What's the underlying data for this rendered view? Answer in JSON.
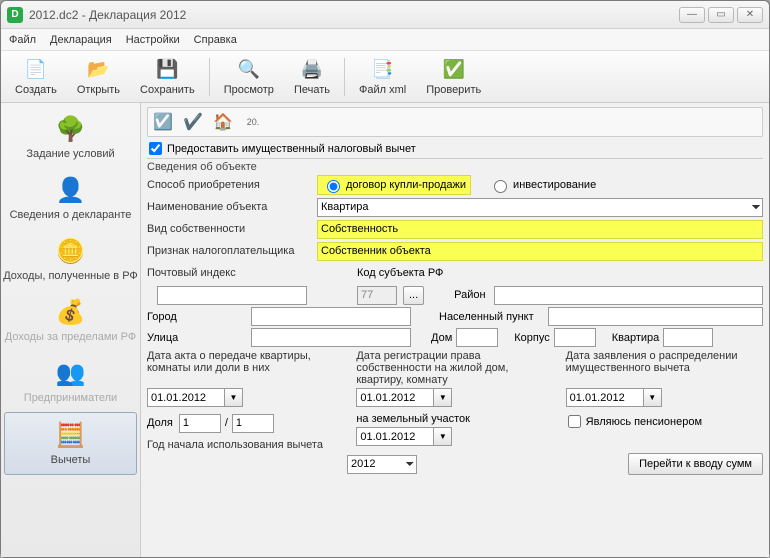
{
  "window": {
    "title": "2012.dc2 - Декларация 2012",
    "appicon": "D"
  },
  "menu": [
    "Файл",
    "Декларация",
    "Настройки",
    "Справка"
  ],
  "toolbar": {
    "create": "Создать",
    "open": "Открыть",
    "save": "Сохранить",
    "preview": "Просмотр",
    "print": "Печать",
    "xml": "Файл xml",
    "check": "Проверить"
  },
  "sidebar": {
    "items": [
      {
        "label": "Задание условий"
      },
      {
        "label": "Сведения о декларанте"
      },
      {
        "label": "Доходы, полученные в РФ"
      },
      {
        "label": "Доходы за пределами РФ"
      },
      {
        "label": "Предприниматели"
      },
      {
        "label": "Вычеты"
      }
    ]
  },
  "section": {
    "provide_checkbox": "Предоставить имущественный налоговый вычет",
    "group_title": "Сведения об объекте",
    "acq_label": "Способ приобретения",
    "acq_opt1": "договор купли-продажи",
    "acq_opt2": "инвестирование",
    "objname_label": "Наименование объекта",
    "objname_value": "Квартира",
    "ownkind_label": "Вид собственности",
    "ownkind_value": "Собственность",
    "taxpayer_label": "Признак налогоплательщика",
    "taxpayer_value": "Собственник объекта",
    "zip_label": "Почтовый индекс",
    "region_label": "Код субъекта РФ",
    "region_value": "77",
    "region_btn": "...",
    "district_label": "Район",
    "city_label": "Город",
    "town_label": "Населенный пункт",
    "street_label": "Улица",
    "house_label": "Дом",
    "building_label": "Корпус",
    "flat_label": "Квартира",
    "col1_label": "Дата акта о передаче квартиры, комнаты или доли в них",
    "col2_label": "Дата регистрации права собственности на жилой дом, квартиру, комнату",
    "col3_label": "Дата заявления о распределении имущественного вычета",
    "land_label": "на земельный участок",
    "date_value": "01.01.2012",
    "share_label": "Доля",
    "share_num": "1",
    "share_den": "1",
    "share_sep": "/",
    "pension_label": "Являюсь пенсионером",
    "year_label": "Год начала использования вычета",
    "year_value": "2012",
    "goto_btn": "Перейти к вводу сумм",
    "page_mini": "20."
  }
}
